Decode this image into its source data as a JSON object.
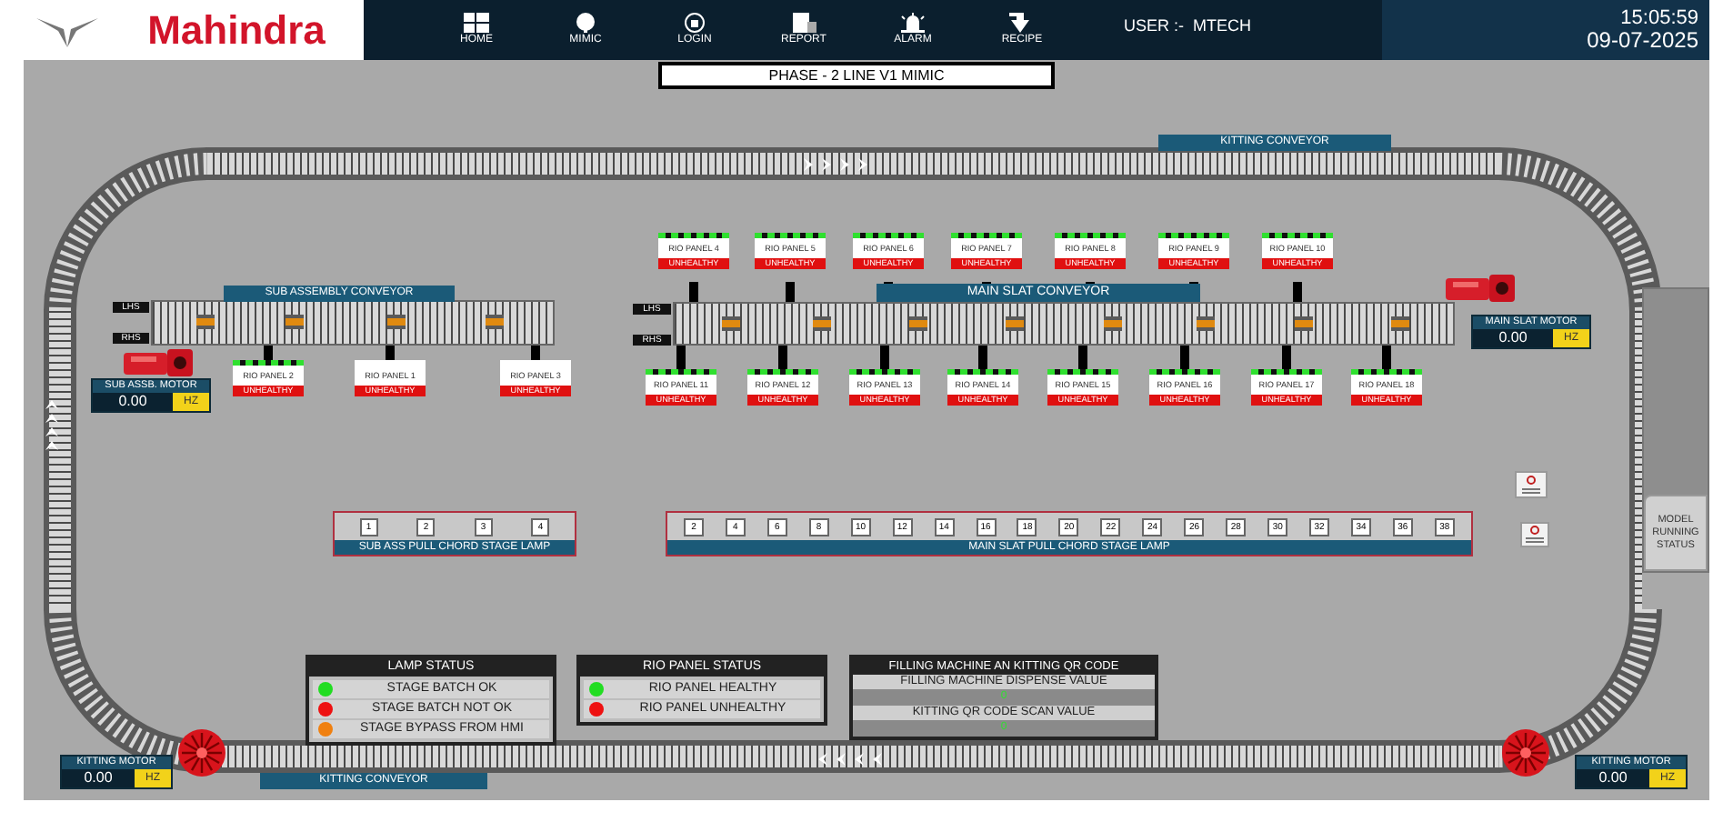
{
  "header": {
    "logo_text": "Mahindra",
    "nav": [
      {
        "label": "HOME",
        "kind": "home"
      },
      {
        "label": "MIMIC",
        "kind": "mimic"
      },
      {
        "label": "LOGIN",
        "kind": "login"
      },
      {
        "label": "REPORT",
        "kind": "report"
      },
      {
        "label": "ALARM",
        "kind": "alarm"
      },
      {
        "label": "RECIPE",
        "kind": "recipe"
      }
    ],
    "user_label": "USER :-",
    "user": "MTECH",
    "time": "15:05:59",
    "date": "09-07-2025"
  },
  "title": "PHASE - 2 LINE V1 MIMIC",
  "kitting_conveyor_top": "KITTING CONVEYOR",
  "sub_assembly": {
    "label": "SUB ASSEMBLY CONVEYOR",
    "lhs": "LHS",
    "rhs": "RHS",
    "panels": [
      {
        "label": "RIO PANEL 2",
        "status": "UNHEALTHY",
        "healthy": false,
        "lamps_on": true
      },
      {
        "label": "RIO PANEL 1",
        "status": "UNHEALTHY",
        "healthy": false,
        "lamps_on": false
      },
      {
        "label": "RIO PANEL 3",
        "status": "UNHEALTHY",
        "healthy": false,
        "lamps_on": false
      }
    ],
    "motor": {
      "label": "SUB ASSB. MOTOR",
      "value": "0.00",
      "unit": "HZ"
    }
  },
  "main_slat": {
    "label": "MAIN SLAT CONVEYOR",
    "lhs": "LHS",
    "rhs": "RHS",
    "top_panels": [
      {
        "label": "RIO PANEL 4",
        "status": "UNHEALTHY",
        "healthy": false,
        "lamps_on": true
      },
      {
        "label": "RIO PANEL 5",
        "status": "UNHEALTHY",
        "healthy": false,
        "lamps_on": true
      },
      {
        "label": "RIO PANEL 6",
        "status": "UNHEALTHY",
        "healthy": false,
        "lamps_on": true
      },
      {
        "label": "RIO PANEL 7",
        "status": "UNHEALTHY",
        "healthy": false,
        "lamps_on": true
      },
      {
        "label": "RIO PANEL 8",
        "status": "UNHEALTHY",
        "healthy": false,
        "lamps_on": true
      },
      {
        "label": "RIO PANEL 9",
        "status": "UNHEALTHY",
        "healthy": false,
        "lamps_on": true
      },
      {
        "label": "RIO PANEL 10",
        "status": "UNHEALTHY",
        "healthy": false,
        "lamps_on": true
      }
    ],
    "bottom_panels": [
      {
        "label": "RIO PANEL 11",
        "status": "UNHEALTHY",
        "healthy": false,
        "lamps_on": true
      },
      {
        "label": "RIO PANEL 12",
        "status": "UNHEALTHY",
        "healthy": false,
        "lamps_on": true
      },
      {
        "label": "RIO PANEL 13",
        "status": "UNHEALTHY",
        "healthy": false,
        "lamps_on": true
      },
      {
        "label": "RIO PANEL 14",
        "status": "UNHEALTHY",
        "healthy": false,
        "lamps_on": true
      },
      {
        "label": "RIO PANEL 15",
        "status": "UNHEALTHY",
        "healthy": false,
        "lamps_on": true
      },
      {
        "label": "RIO PANEL 16",
        "status": "UNHEALTHY",
        "healthy": false,
        "lamps_on": true
      },
      {
        "label": "RIO PANEL 17",
        "status": "UNHEALTHY",
        "healthy": false,
        "lamps_on": true
      },
      {
        "label": "RIO PANEL 18",
        "status": "UNHEALTHY",
        "healthy": false,
        "lamps_on": true
      }
    ],
    "motor": {
      "label": "MAIN SLAT MOTOR",
      "value": "0.00",
      "unit": "HZ"
    }
  },
  "sub_pull_chord": {
    "label": "SUB ASS PULL CHORD STAGE LAMP",
    "lamps": [
      "1",
      "2",
      "3",
      "4"
    ]
  },
  "main_pull_chord": {
    "label": "MAIN SLAT PULL CHORD STAGE LAMP",
    "lamps": [
      "2",
      "4",
      "6",
      "8",
      "10",
      "12",
      "14",
      "16",
      "18",
      "20",
      "22",
      "24",
      "26",
      "28",
      "30",
      "32",
      "34",
      "36",
      "38"
    ]
  },
  "model_status": "MODEL RUNNING STATUS",
  "lamp_status": {
    "title": "LAMP STATUS",
    "items": [
      {
        "label": "STAGE BATCH OK",
        "color": "#22dd22"
      },
      {
        "label": "STAGE BATCH NOT OK",
        "color": "#ee1111"
      },
      {
        "label": "STAGE BYPASS FROM HMI",
        "color": "#f08010"
      }
    ]
  },
  "rio_status": {
    "title": "RIO PANEL STATUS",
    "items": [
      {
        "label": "RIO PANEL HEALTHY",
        "color": "#22dd22"
      },
      {
        "label": "RIO PANEL UNHEALTHY",
        "color": "#ee1111"
      }
    ]
  },
  "qr": {
    "title": "FILLING MACHINE AN KITTING QR CODE",
    "rows": [
      {
        "label": "FILLING MACHINE DISPENSE VALUE",
        "value": "0"
      },
      {
        "label": "KITTING QR CODE SCAN VALUE",
        "value": "0"
      }
    ]
  },
  "kitting_motors": [
    {
      "label": "KITTING MOTOR",
      "value": "0.00",
      "unit": "HZ"
    },
    {
      "label": "KITTING MOTOR",
      "value": "0.00",
      "unit": "HZ"
    }
  ],
  "kitting_conveyor_bottom": "KITTING CONVEYOR"
}
